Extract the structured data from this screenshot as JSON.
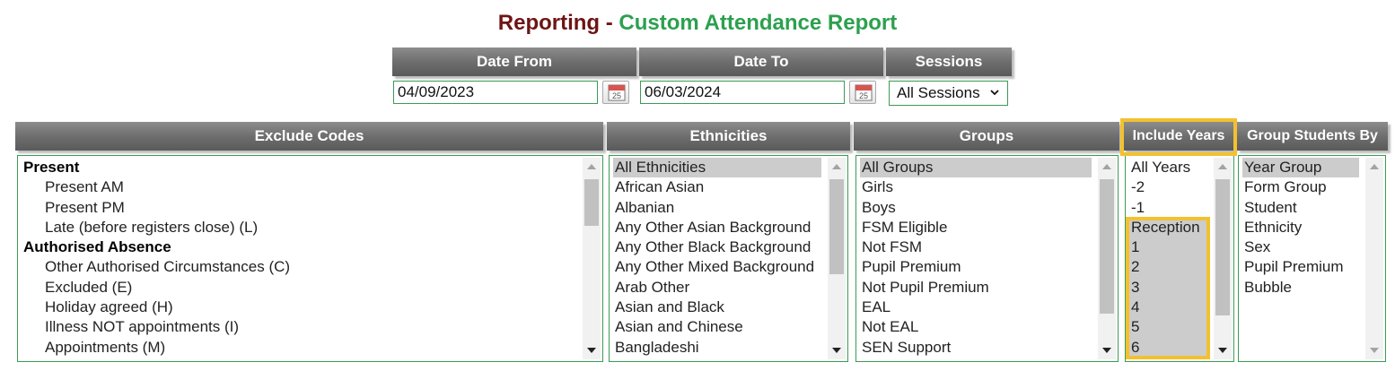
{
  "title": {
    "prefix": "Reporting - ",
    "main": "Custom Attendance Report"
  },
  "filters": {
    "date_from_label": "Date From",
    "date_to_label": "Date To",
    "sessions_label": "Sessions",
    "date_from_value": "04/09/2023",
    "date_to_value": "06/03/2024",
    "calendar_day": "25",
    "sessions_value": "All Sessions"
  },
  "panels": {
    "exclude_codes": {
      "label": "Exclude Codes",
      "items": [
        {
          "text": "Present",
          "type": "group"
        },
        {
          "text": "Present AM",
          "type": "item"
        },
        {
          "text": "Present PM",
          "type": "item"
        },
        {
          "text": "Late (before registers close) (L)",
          "type": "item"
        },
        {
          "text": "Authorised Absence",
          "type": "group"
        },
        {
          "text": "Other Authorised Circumstances (C)",
          "type": "item"
        },
        {
          "text": "Excluded (E)",
          "type": "item"
        },
        {
          "text": "Holiday agreed (H)",
          "type": "item"
        },
        {
          "text": "Illness NOT appointments (I)",
          "type": "item"
        },
        {
          "text": "Appointments (M)",
          "type": "item"
        }
      ]
    },
    "ethnicities": {
      "label": "Ethnicities",
      "items": [
        "All Ethnicities",
        "African Asian",
        "Albanian",
        "Any Other Asian Background",
        "Any Other Black Background",
        "Any Other Mixed Background",
        "Arab Other",
        "Asian and Black",
        "Asian and Chinese",
        "Bangladeshi"
      ],
      "selected": "All Ethnicities"
    },
    "groups": {
      "label": "Groups",
      "items": [
        "All Groups",
        "Girls",
        "Boys",
        "FSM Eligible",
        "Not FSM",
        "Pupil Premium",
        "Not Pupil Premium",
        "EAL",
        "Not EAL",
        "SEN Support"
      ],
      "selected": "All Groups"
    },
    "include_years": {
      "label": "Include Years",
      "items": [
        "All Years",
        "-2",
        "-1",
        "Reception",
        "1",
        "2",
        "3",
        "4",
        "5",
        "6"
      ],
      "selected": [
        "Reception",
        "1",
        "2",
        "3",
        "4",
        "5",
        "6"
      ]
    },
    "group_students_by": {
      "label": "Group Students By",
      "items": [
        "Year Group",
        "Form Group",
        "Student",
        "Ethnicity",
        "Sex",
        "Pupil Premium",
        "Bubble"
      ],
      "selected": "Year Group"
    }
  },
  "colors": {
    "title_dark": "#6e1414",
    "title_green": "#2ca04f",
    "highlight": "#f3c130",
    "border_green": "#3b9b55"
  }
}
